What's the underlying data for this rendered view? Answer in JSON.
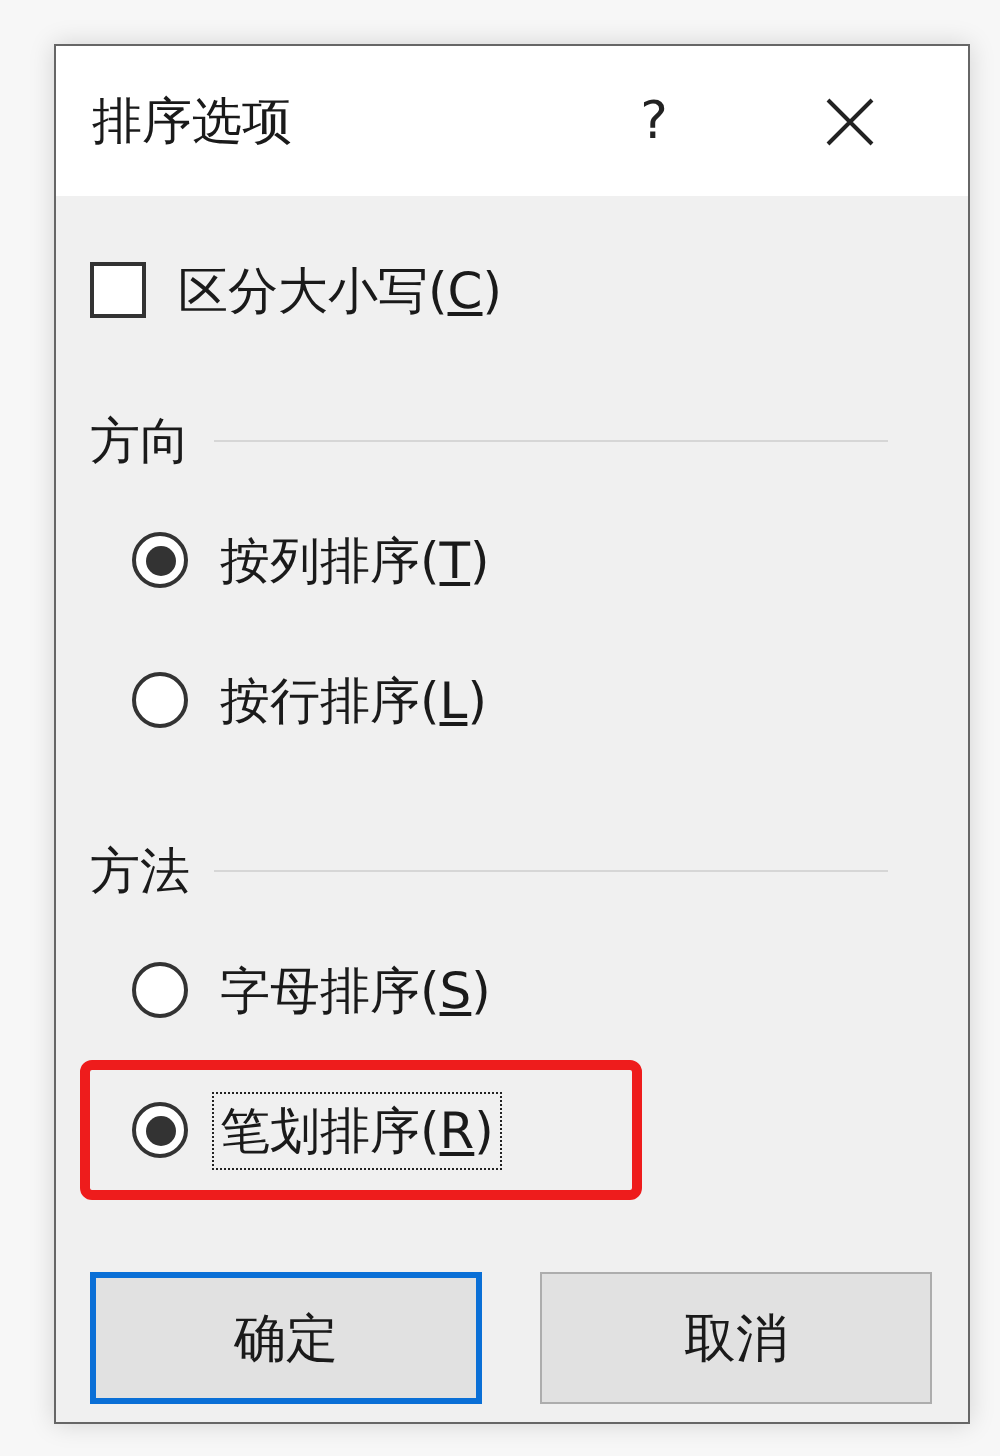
{
  "window": {
    "title": "排序选项",
    "help": "?"
  },
  "checkbox": {
    "label_before": "区分大小写(",
    "mnemonic": "C",
    "label_after": ")",
    "checked": false
  },
  "sections": [
    {
      "heading": "方向",
      "options": [
        {
          "label_before": "按列排序(",
          "mnemonic": "T",
          "label_after": ")",
          "selected": true,
          "focused": false,
          "highlighted": false
        },
        {
          "label_before": "按行排序(",
          "mnemonic": "L",
          "label_after": ")",
          "selected": false,
          "focused": false,
          "highlighted": false
        }
      ]
    },
    {
      "heading": "方法",
      "options": [
        {
          "label_before": "字母排序(",
          "mnemonic": "S",
          "label_after": ")",
          "selected": false,
          "focused": false,
          "highlighted": false
        },
        {
          "label_before": "笔划排序(",
          "mnemonic": "R",
          "label_after": ")",
          "selected": true,
          "focused": true,
          "highlighted": true
        }
      ]
    }
  ],
  "buttons": [
    {
      "label": "确定",
      "default": true
    },
    {
      "label": "取消",
      "default": false
    }
  ]
}
